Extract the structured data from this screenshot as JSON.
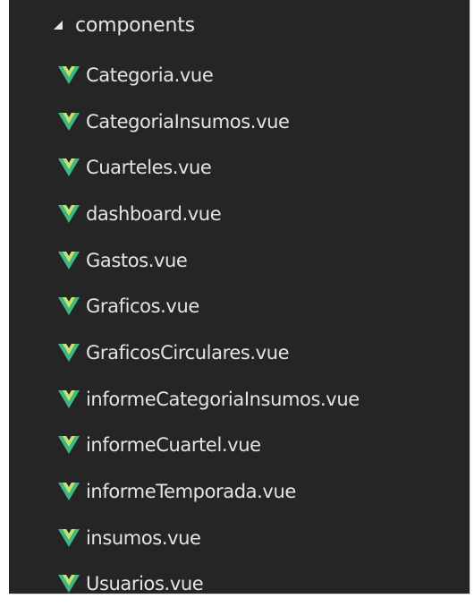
{
  "explorer": {
    "folder": {
      "name": "components",
      "expanded": true,
      "icon": "twistie-expanded-icon"
    },
    "files": [
      {
        "name": "Categoria.vue",
        "icon": "vue-icon"
      },
      {
        "name": "CategoriaInsumos.vue",
        "icon": "vue-icon"
      },
      {
        "name": "Cuarteles.vue",
        "icon": "vue-icon"
      },
      {
        "name": "dashboard.vue",
        "icon": "vue-icon"
      },
      {
        "name": "Gastos.vue",
        "icon": "vue-icon"
      },
      {
        "name": "Graficos.vue",
        "icon": "vue-icon"
      },
      {
        "name": "GraficosCirculares.vue",
        "icon": "vue-icon"
      },
      {
        "name": "informeCategoriaInsumos.vue",
        "icon": "vue-icon"
      },
      {
        "name": "informeCuartel.vue",
        "icon": "vue-icon"
      },
      {
        "name": "informeTemporada.vue",
        "icon": "vue-icon"
      },
      {
        "name": "insumos.vue",
        "icon": "vue-icon"
      },
      {
        "name": "Usuarios.vue",
        "icon": "vue-icon"
      }
    ]
  },
  "colors": {
    "background": "#252526",
    "text": "#e4e4e4",
    "vue_outer": "#41b883",
    "vue_inner": "#c8e36b"
  }
}
